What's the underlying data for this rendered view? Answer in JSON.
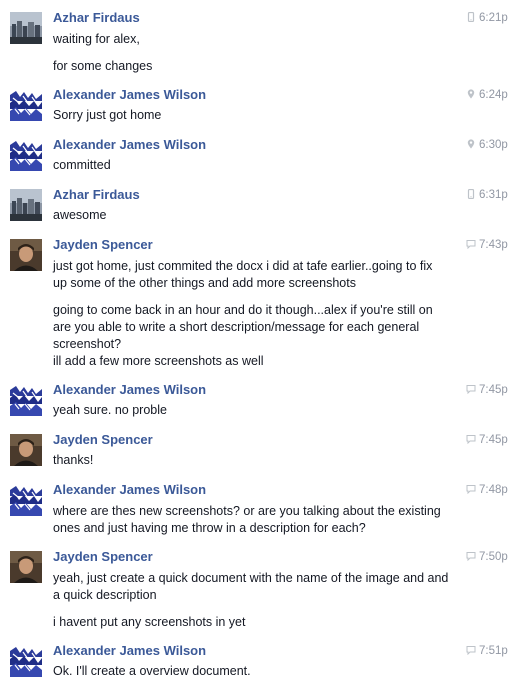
{
  "messages": [
    {
      "author": "Azhar Firdaus",
      "time": "6:21p",
      "icon": "mobile-icon",
      "avatar": "city-photo",
      "lines": [
        "waiting for alex,",
        "for some changes"
      ]
    },
    {
      "author": "Alexander James Wilson",
      "time": "6:24p",
      "icon": "location-pin-icon",
      "avatar": "blue-pattern",
      "lines": [
        "Sorry just got home"
      ]
    },
    {
      "author": "Alexander James Wilson",
      "time": "6:30p",
      "icon": "location-pin-icon",
      "avatar": "blue-pattern",
      "lines": [
        "committed"
      ]
    },
    {
      "author": "Azhar Firdaus",
      "time": "6:31p",
      "icon": "mobile-icon",
      "avatar": "city-photo",
      "lines": [
        "awesome"
      ]
    },
    {
      "author": "Jayden Spencer",
      "time": "7:43p",
      "icon": "chat-bubble-icon",
      "avatar": "person-photo",
      "lines": [
        "just got home, just commited the docx i did at tafe earlier..going to fix",
        "up some of the other things and add more screenshots",
        "going to come back in an hour and do it though...alex if you're still on",
        "are you able to write a short description/message for each general",
        "screenshot?",
        "ill add a few more screenshots as well"
      ]
    },
    {
      "author": "Alexander James Wilson",
      "time": "7:45p",
      "icon": "chat-bubble-icon",
      "avatar": "blue-pattern",
      "lines": [
        "yeah sure. no proble"
      ]
    },
    {
      "author": "Jayden Spencer",
      "time": "7:45p",
      "icon": "chat-bubble-icon",
      "avatar": "person-photo",
      "lines": [
        "thanks!"
      ]
    },
    {
      "author": "Alexander James Wilson",
      "time": "7:48p",
      "icon": "chat-bubble-icon",
      "avatar": "blue-pattern",
      "lines": [
        "where are thes new screenshots? or are you talking about the existing",
        "ones and just having me throw in a description for each?"
      ]
    },
    {
      "author": "Jayden Spencer",
      "time": "7:50p",
      "icon": "chat-bubble-icon",
      "avatar": "person-photo",
      "lines": [
        "yeah, just create a quick document with the name of the image and and",
        "a quick description",
        "i havent put any screenshots in yet"
      ]
    },
    {
      "author": "Alexander James Wilson",
      "time": "7:51p",
      "icon": "chat-bubble-icon",
      "avatar": "blue-pattern",
      "lines": [
        "Ok. I'll create a overview document."
      ]
    }
  ]
}
